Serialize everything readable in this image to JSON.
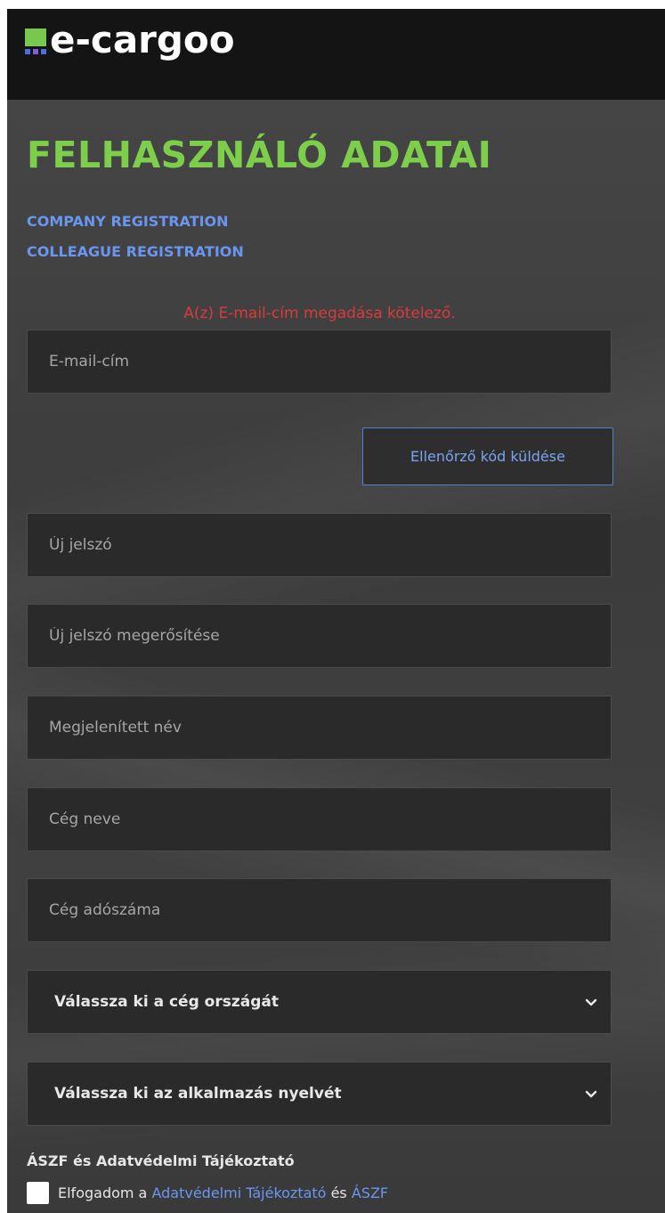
{
  "brand": {
    "name": "e-cargoo",
    "logo_colors": {
      "block": "#78c850",
      "dots": [
        "#4f6fd8",
        "#7c5fd8",
        "#4f6fd8"
      ]
    }
  },
  "page": {
    "title": "FELHASZNÁLÓ ADATAI",
    "links": {
      "company_registration": "COMPANY REGISTRATION",
      "colleague_registration": "COLLEAGUE REGISTRATION"
    },
    "error_message": "A(z) E-mail-cím megadása kötelező."
  },
  "form": {
    "email": {
      "placeholder": "E-mail-cím",
      "value": ""
    },
    "send_code_button": "Ellenőrző kód küldése",
    "new_password": {
      "placeholder": "Új jelszó",
      "value": ""
    },
    "confirm_password": {
      "placeholder": "Új jelszó megerősítése",
      "value": ""
    },
    "display_name": {
      "placeholder": "Megjelenített név",
      "value": ""
    },
    "company_name": {
      "placeholder": "Cég neve",
      "value": ""
    },
    "company_tax_number": {
      "placeholder": "Cég adószáma",
      "value": ""
    },
    "country_select": {
      "selected": "Válassza ki a cég országát"
    },
    "language_select": {
      "selected": "Válassza ki az alkalmazás nyelvét"
    }
  },
  "terms": {
    "heading": "ÁSZF és Adatvédelmi Tájékoztató",
    "accept_prefix": "Elfogadom a",
    "privacy_link": "Adatvédelmi Tájékoztató",
    "conjunction": "és",
    "terms_link": "ÁSZF",
    "checked": false
  },
  "colors": {
    "accent_green": "#7dcf4b",
    "link_blue": "#6a96f0",
    "error_red": "#d93b3b",
    "header_bg": "#141414"
  }
}
